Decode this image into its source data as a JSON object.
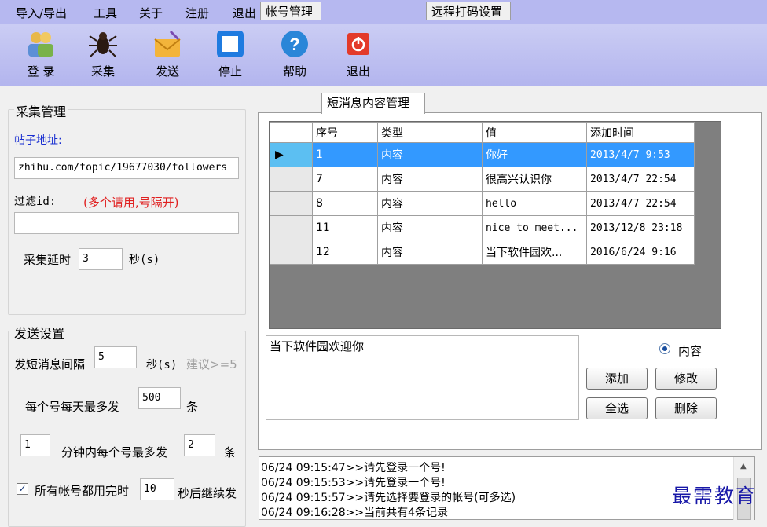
{
  "menu": [
    "导入/导出",
    "工具",
    "关于",
    "注册",
    "退出"
  ],
  "toolbar": {
    "login": "登 录",
    "collect": "采集",
    "send": "发送",
    "stop": "停止",
    "help": "帮助",
    "exit": "退出",
    "help_glyph": "?"
  },
  "collect_mgmt": {
    "title": "采集管理",
    "post_url_label": "帖子地址:",
    "post_url_value": "zhihu.com/topic/19677030/followers",
    "filter_label": "过滤id:",
    "filter_hint": "(多个请用,号隔开)",
    "filter_value": "",
    "delay_label": "采集延时",
    "delay_value": "3",
    "delay_unit": "秒(s)"
  },
  "send_settings": {
    "title": "发送设置",
    "interval_label": "发短消息间隔",
    "interval_value": "5",
    "interval_unit": "秒(s)",
    "interval_hint": "建议>=5",
    "daily_label": "每个号每天最多发",
    "daily_value": "500",
    "daily_unit": "条",
    "per_min_value": "1",
    "per_min_label": "分钟内每个号最多发",
    "per_min_count": "2",
    "per_min_unit": "条",
    "all_used_label": "所有帐号都用完时",
    "all_used_value": "10",
    "all_used_unit": "秒后继续发",
    "all_used_checked": true,
    "check_glyph": "✓"
  },
  "tabs": [
    "帐号管理",
    "短消息内容管理",
    "远程打码设置"
  ],
  "grid": {
    "columns": [
      "序号",
      "类型",
      "值",
      "添加时间"
    ],
    "row_marker": "▶",
    "rows": [
      {
        "id": "1",
        "type": "内容",
        "value": "你好",
        "time": "2013/4/7 9:53",
        "selected": true
      },
      {
        "id": "7",
        "type": "内容",
        "value": "很高兴认识你",
        "time": "2013/4/7 22:54"
      },
      {
        "id": "8",
        "type": "内容",
        "value": "hello",
        "time": "2013/4/7 22:54"
      },
      {
        "id": "11",
        "type": "内容",
        "value": "nice to meet...",
        "time": "2013/12/8 23:18"
      },
      {
        "id": "12",
        "type": "内容",
        "value": "当下软件园欢...",
        "time": "2016/6/24 9:16"
      }
    ]
  },
  "editor": {
    "text": "当下软件园欢迎你",
    "radio_label": "内容",
    "add": "添加",
    "edit": "修改",
    "select_all": "全选",
    "delete": "删除"
  },
  "log": [
    "06/24 09:15:47>>请先登录一个号!",
    "06/24 09:15:53>>请先登录一个号!",
    "06/24 09:15:57>>请先选择要登录的帐号(可多选)",
    "06/24 09:16:28>>当前共有4条记录"
  ],
  "scroll_up": "▲",
  "watermark": "最需教育",
  "colors": {
    "menubar": "#b6b8f0",
    "selection": "#3399ff",
    "link": "#1a2fd1",
    "hint_red": "#e02020"
  }
}
